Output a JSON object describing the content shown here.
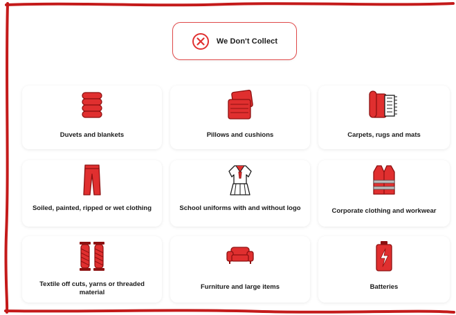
{
  "header": {
    "title": "We Don't Collect",
    "icon": "x-circle-icon"
  },
  "colors": {
    "accent": "#e02f2f",
    "border": "#c41a1a",
    "text": "#1a1a1a"
  },
  "items": [
    {
      "label": "Duvets and blankets",
      "icon": "duvet-icon"
    },
    {
      "label": "Pillows and cushions",
      "icon": "pillow-icon"
    },
    {
      "label": "Carpets, rugs and mats",
      "icon": "carpet-roll-icon"
    },
    {
      "label": "Soiled, painted, ripped or wet clothing",
      "icon": "trousers-icon"
    },
    {
      "label": "School uniforms with and without logo",
      "icon": "school-uniform-icon"
    },
    {
      "label": "Corporate clothing and workwear",
      "icon": "hi-vis-vest-icon"
    },
    {
      "label": "Textile off cuts, yarns or threaded material",
      "icon": "yarn-spools-icon"
    },
    {
      "label": "Furniture and large items",
      "icon": "sofa-icon"
    },
    {
      "label": "Batteries",
      "icon": "battery-icon"
    }
  ]
}
